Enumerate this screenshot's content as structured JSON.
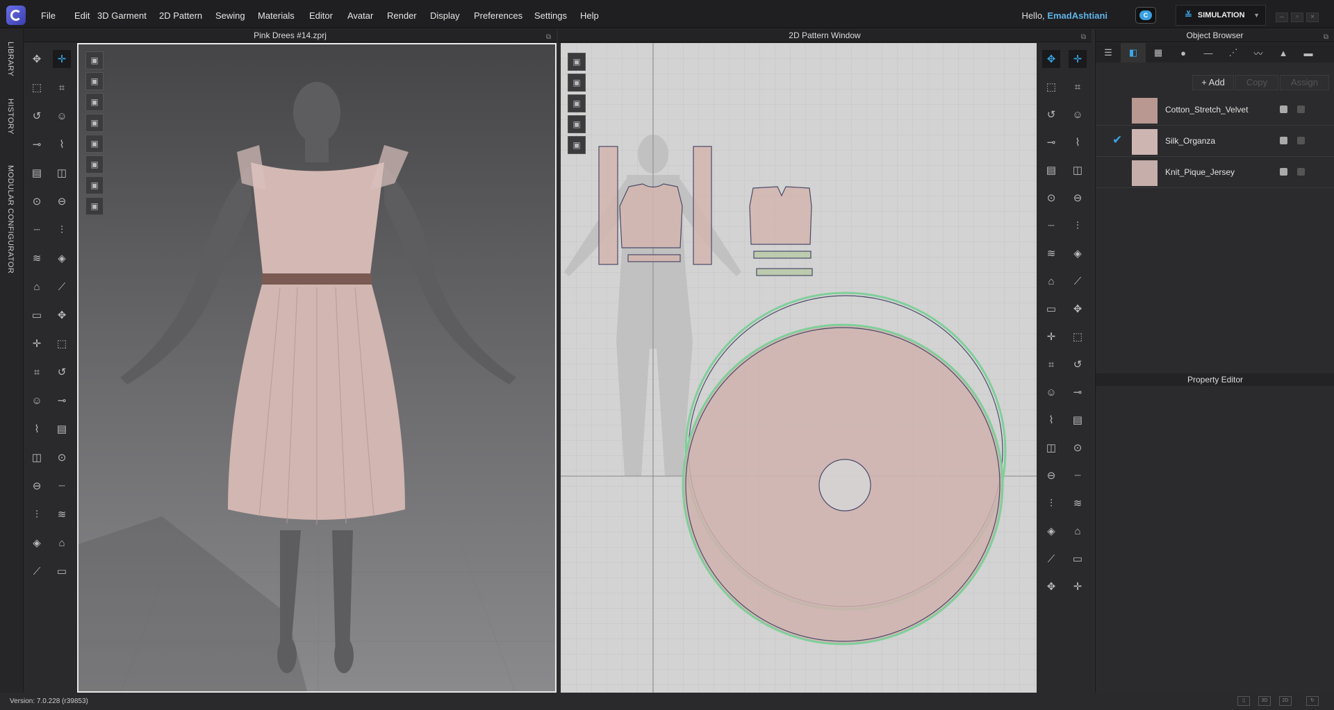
{
  "app": {
    "name": "CLO 3D"
  },
  "menu": [
    "File",
    "Edit",
    "3D Garment",
    "2D Pattern",
    "Sewing",
    "Materials",
    "Editor",
    "Avatar",
    "Render",
    "Display",
    "Preferences",
    "Settings",
    "Help"
  ],
  "user": {
    "greeting": "Hello,",
    "name": "EmadAshtiani"
  },
  "cloud_icon": "C",
  "mode": {
    "label": "SIMULATION"
  },
  "window_controls": {
    "minimize": "–",
    "restore": "▫",
    "close": "×"
  },
  "vertical_tabs": [
    "LIBRARY",
    "HISTORY",
    "MODULAR CONFIGURATOR"
  ],
  "viewport3d": {
    "title": "Pink Drees #14.zprj"
  },
  "pattern2d": {
    "title": "2D Pattern Window"
  },
  "tools3d": [
    "transform-pattern",
    "move",
    "select-mesh",
    "fold-arrangement",
    "reset-2d",
    "avatar-arrange",
    "pin",
    "tuck",
    "strengthen",
    "shrinkage",
    "button",
    "buttonhole",
    "topstitch",
    "zipper",
    "puckering",
    "trim",
    "fitting",
    "sewing",
    "tape"
  ],
  "tools2d_right": [
    "select-pattern",
    "edit-pattern",
    "transform",
    "polygon",
    "rectangle",
    "internal-polygon",
    "dart",
    "segment-sewing",
    "free-sewing",
    "fold",
    "notch",
    "ruler",
    "text",
    "baseline",
    "grid",
    "tape",
    "zipper",
    "iron",
    "puckering",
    "trim"
  ],
  "object_browser": {
    "title": "Object Browser",
    "tabs": [
      "list",
      "fabric",
      "graphic",
      "button",
      "buttonhole",
      "topstitch",
      "zipper",
      "trim",
      "measure"
    ],
    "add_label": "+ Add",
    "copy_label": "Copy",
    "assign_label": "Assign",
    "materials": [
      {
        "name": "Cotton_Stretch_Velvet",
        "color": "#b89891",
        "selected": false
      },
      {
        "name": "Silk_Organza",
        "color": "#cdb6b2",
        "selected": true
      },
      {
        "name": "Knit_Pique_Jersey",
        "color": "#c6aeaa",
        "selected": false
      }
    ],
    "check_icon": "✔"
  },
  "property_editor": {
    "title": "Property Editor"
  },
  "status": {
    "version": "Version: 7.0.228 (r39853)",
    "view_buttons": [
      "▯",
      "3D",
      "2D",
      "↻"
    ]
  },
  "colors": {
    "accent": "#36a6e8",
    "fabric": "#cdb3ae",
    "pattern_outline": "#4a4a6a",
    "selected_outline": "#7fcf9a"
  }
}
